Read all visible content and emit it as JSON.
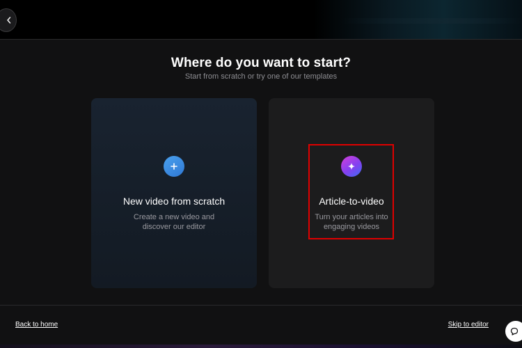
{
  "header": {
    "back_icon": "chevron-left-icon"
  },
  "main": {
    "title": "Where do you want to start?",
    "subtitle": "Start from scratch or try one of our templates",
    "cards": [
      {
        "icon": "plus-icon",
        "icon_color": "#3b8de3",
        "title": "New video from scratch",
        "desc_line1": "Create a new video and",
        "desc_line2": "discover our editor"
      },
      {
        "icon": "sparkle-icon",
        "icon_color": "#a041e8",
        "title": "Article-to-video",
        "desc_line1": "Turn your articles into",
        "desc_line2": "engaging videos"
      }
    ]
  },
  "footer": {
    "back_label": "Back to home",
    "skip_label": "Skip to editor",
    "chat_icon": "chat-bubble-icon"
  },
  "colors": {
    "background": "#111112",
    "highlight": "#e00000"
  }
}
